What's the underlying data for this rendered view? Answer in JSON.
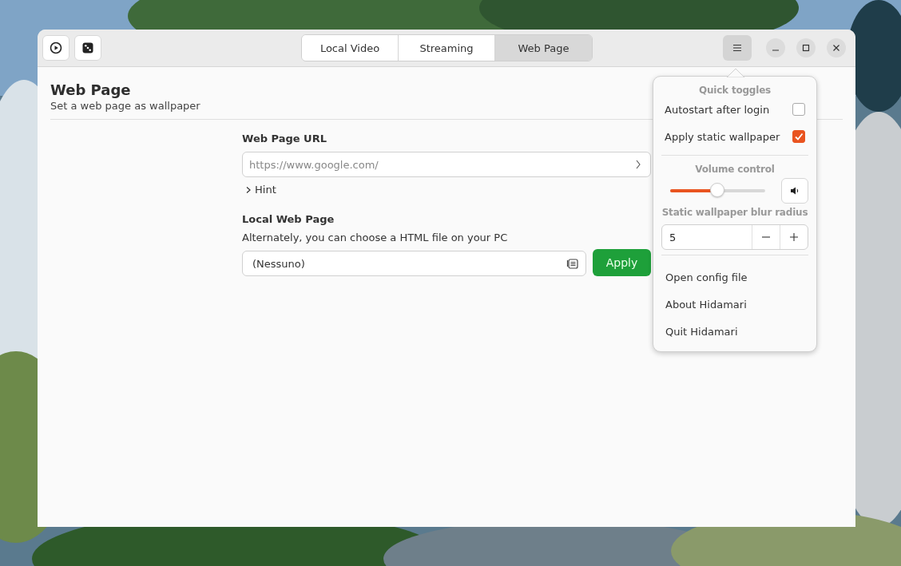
{
  "header": {
    "tabs": [
      {
        "label": "Local Video",
        "selected": false
      },
      {
        "label": "Streaming",
        "selected": false
      },
      {
        "label": "Web Page",
        "selected": true
      }
    ],
    "menu_open": true
  },
  "page": {
    "title": "Web Page",
    "subtitle": "Set a web page as wallpaper",
    "url_label": "Web Page URL",
    "url_placeholder": "https://www.google.com/",
    "hint": "Hint",
    "hint_expanded": false,
    "local_label": "Local Web Page",
    "local_desc": "Alternately, you can choose a HTML file on your PC",
    "file_value": "(Nessuno)",
    "apply": "Apply"
  },
  "menu": {
    "quick_title": "Quick toggles",
    "toggles": [
      {
        "label": "Autostart after login",
        "checked": false
      },
      {
        "label": "Apply static wallpaper",
        "checked": true
      }
    ],
    "volume_title": "Volume control",
    "volume": {
      "level": 0.5
    },
    "blur_title": "Static wallpaper blur radius",
    "blur_value": "5",
    "items": [
      "Open config file",
      "About Hidamari",
      "Quit Hidamari"
    ]
  }
}
